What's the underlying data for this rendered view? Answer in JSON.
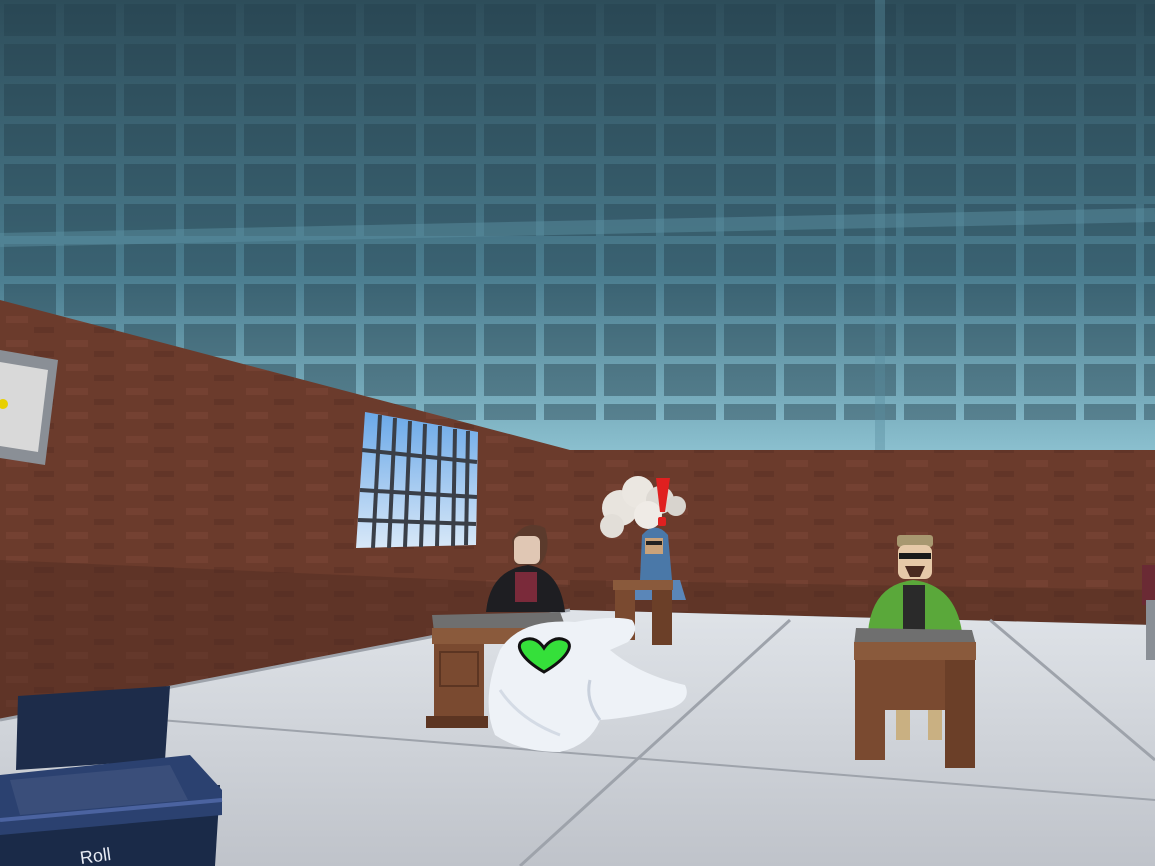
{
  "scene": {
    "title": "",
    "hud_label": "Roll"
  },
  "icons": {
    "status": "green-heart-icon",
    "alert": "red-exclamation-icon",
    "smoke": "smoke-cloud-icon"
  },
  "colors": {
    "ceiling": "#3f6a7a",
    "ceiling_dark": "#2b4a57",
    "brick_wall": "#6a3a2c",
    "floor": "#c9ccd2",
    "heart": "#35e03a",
    "alert": "#e02020",
    "desk": "#7a4a30",
    "glove": "#eef2f7"
  }
}
